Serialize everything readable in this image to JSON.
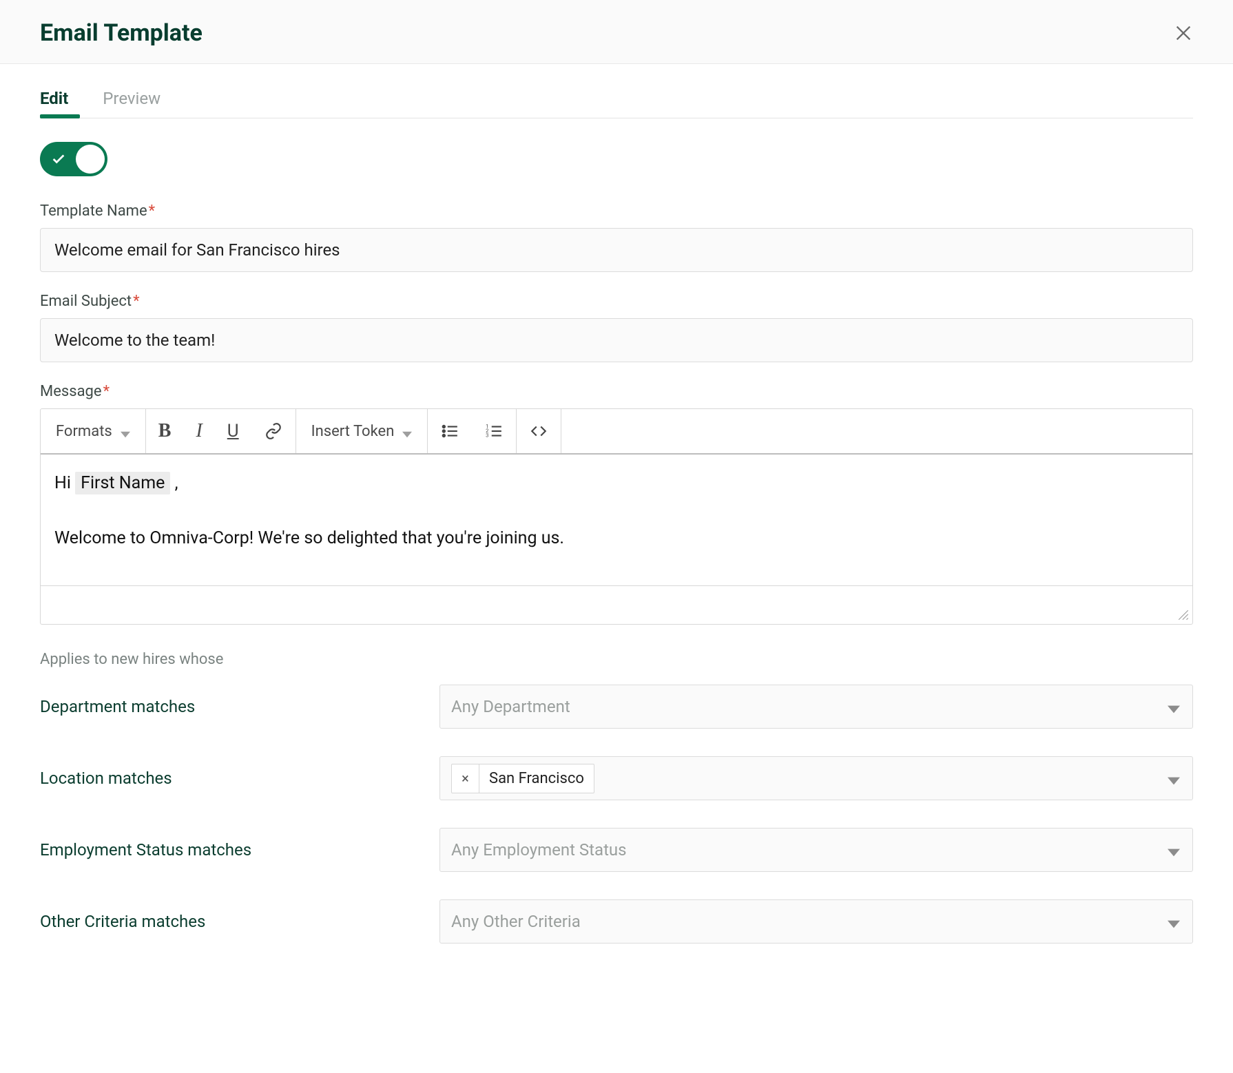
{
  "header": {
    "title": "Email Template"
  },
  "tabs": {
    "edit": "Edit",
    "preview": "Preview",
    "active": "edit"
  },
  "toggle": {
    "on": true
  },
  "fields": {
    "template_name": {
      "label": "Template Name",
      "required": "*",
      "value": "Welcome email for San Francisco hires"
    },
    "email_subject": {
      "label": "Email Subject",
      "required": "*",
      "value": "Welcome to the team!"
    },
    "message": {
      "label": "Message",
      "required": "*"
    }
  },
  "editor": {
    "formats_label": "Formats",
    "insert_token_label": "Insert Token",
    "body": {
      "greeting_prefix": "Hi ",
      "token": "First Name",
      "greeting_suffix": " ,",
      "paragraph": "Welcome to Omniva-Corp! We're so delighted that you're joining us."
    }
  },
  "criteria": {
    "intro": "Applies to new hires whose",
    "rows": {
      "department": {
        "label": "Department matches",
        "placeholder": "Any Department",
        "chips": []
      },
      "location": {
        "label": "Location matches",
        "placeholder": "",
        "chips": [
          "San Francisco"
        ]
      },
      "employment_status": {
        "label": "Employment Status matches",
        "placeholder": "Any Employment Status",
        "chips": []
      },
      "other": {
        "label": "Other Criteria matches",
        "placeholder": "Any Other Criteria",
        "chips": []
      }
    }
  },
  "icons": {
    "close": "close-icon",
    "check": "check-icon",
    "bold": "bold-icon",
    "italic": "italic-icon",
    "underline": "underline-icon",
    "link": "link-icon",
    "ul": "unordered-list-icon",
    "ol": "ordered-list-icon",
    "code": "code-icon",
    "caret": "caret-down-icon",
    "chip_remove": "×"
  }
}
